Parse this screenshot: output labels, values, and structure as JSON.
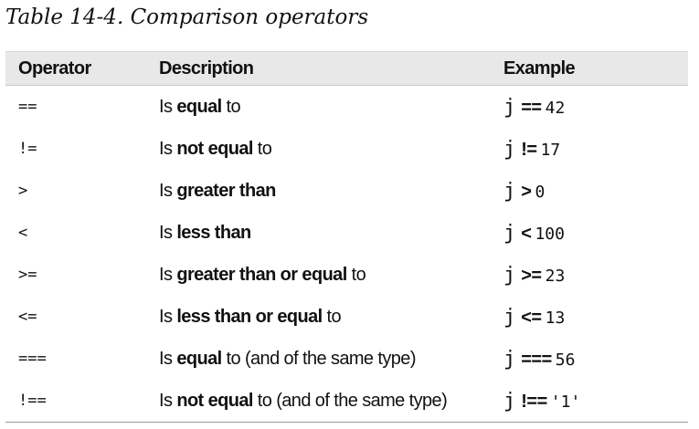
{
  "caption": "Table 14-4. Comparison operators",
  "table": {
    "headers": {
      "operator": "Operator",
      "description": "Description",
      "example": "Example"
    },
    "rows": [
      {
        "operator": "==",
        "desc_pre": "Is ",
        "desc_bold": "equal",
        "desc_post": " to",
        "ex_var": "j",
        "ex_op": "==",
        "ex_val": "42"
      },
      {
        "operator": "!=",
        "desc_pre": "Is ",
        "desc_bold": "not equal",
        "desc_post": " to",
        "ex_var": "j",
        "ex_op": "!=",
        "ex_val": "17"
      },
      {
        "operator": ">",
        "desc_pre": "Is ",
        "desc_bold": "greater than",
        "desc_post": "",
        "ex_var": "j",
        "ex_op": ">",
        "ex_val": "0"
      },
      {
        "operator": "<",
        "desc_pre": "Is ",
        "desc_bold": "less than",
        "desc_post": "",
        "ex_var": "j",
        "ex_op": "<",
        "ex_val": "100"
      },
      {
        "operator": ">=",
        "desc_pre": "Is ",
        "desc_bold": "greater than or equal",
        "desc_post": " to",
        "ex_var": "j",
        "ex_op": ">=",
        "ex_val": "23"
      },
      {
        "operator": "<=",
        "desc_pre": "Is ",
        "desc_bold": "less than or equal",
        "desc_post": " to",
        "ex_var": "j",
        "ex_op": "<=",
        "ex_val": "13"
      },
      {
        "operator": "===",
        "desc_pre": "Is ",
        "desc_bold": "equal",
        "desc_post": " to (and of the same type)",
        "ex_var": "j",
        "ex_op": "===",
        "ex_val": "56"
      },
      {
        "operator": "!==",
        "desc_pre": "Is ",
        "desc_bold": "not equal",
        "desc_post": " to (and of the same type)",
        "ex_var": "j",
        "ex_op": "!==",
        "ex_val": "'1'"
      }
    ]
  }
}
